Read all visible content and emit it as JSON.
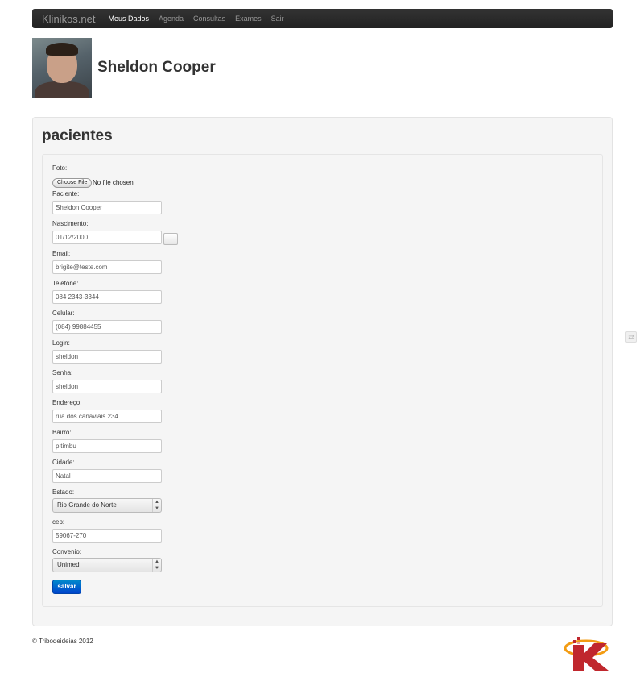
{
  "nav": {
    "brand": "Klinikos.net",
    "items": [
      "Meus Dados",
      "Agenda",
      "Consultas",
      "Exames",
      "Sair"
    ]
  },
  "header": {
    "user_name": "Sheldon Cooper"
  },
  "panel": {
    "title": "pacientes"
  },
  "form": {
    "foto_label": "Foto:",
    "file_button": "Choose File",
    "file_status": "No file chosen",
    "fields": {
      "paciente": {
        "label": "Paciente:",
        "value": "Sheldon Cooper"
      },
      "nascimento": {
        "label": "Nascimento:",
        "value": "01/12/2000"
      },
      "email": {
        "label": "Email:",
        "value": "brigite@teste.com"
      },
      "telefone": {
        "label": "Telefone:",
        "value": "084 2343-3344"
      },
      "celular": {
        "label": "Celular:",
        "value": "(084) 99884455"
      },
      "login": {
        "label": "Login:",
        "value": "sheldon"
      },
      "senha": {
        "label": "Senha:",
        "value": "sheldon"
      },
      "endereco": {
        "label": "Endereço:",
        "value": "rua dos canaviais 234"
      },
      "bairro": {
        "label": "Bairro:",
        "value": "pitimbu"
      },
      "cidade": {
        "label": "Cidade:",
        "value": "Natal"
      },
      "estado": {
        "label": "Estado:",
        "value": "Rio Grande do Norte"
      },
      "cep": {
        "label": "cep:",
        "value": "59067-270"
      },
      "convenio": {
        "label": "Convenio:",
        "value": "Unimed"
      }
    },
    "date_button": "...",
    "submit": "salvar"
  },
  "footer": {
    "text": "© Tribodeideias 2012"
  },
  "colors": {
    "navbar": "#222222",
    "primary_button": "#0066cc",
    "well": "#f5f5f5",
    "logo_red": "#c0272d",
    "logo_orange": "#f39c12"
  }
}
